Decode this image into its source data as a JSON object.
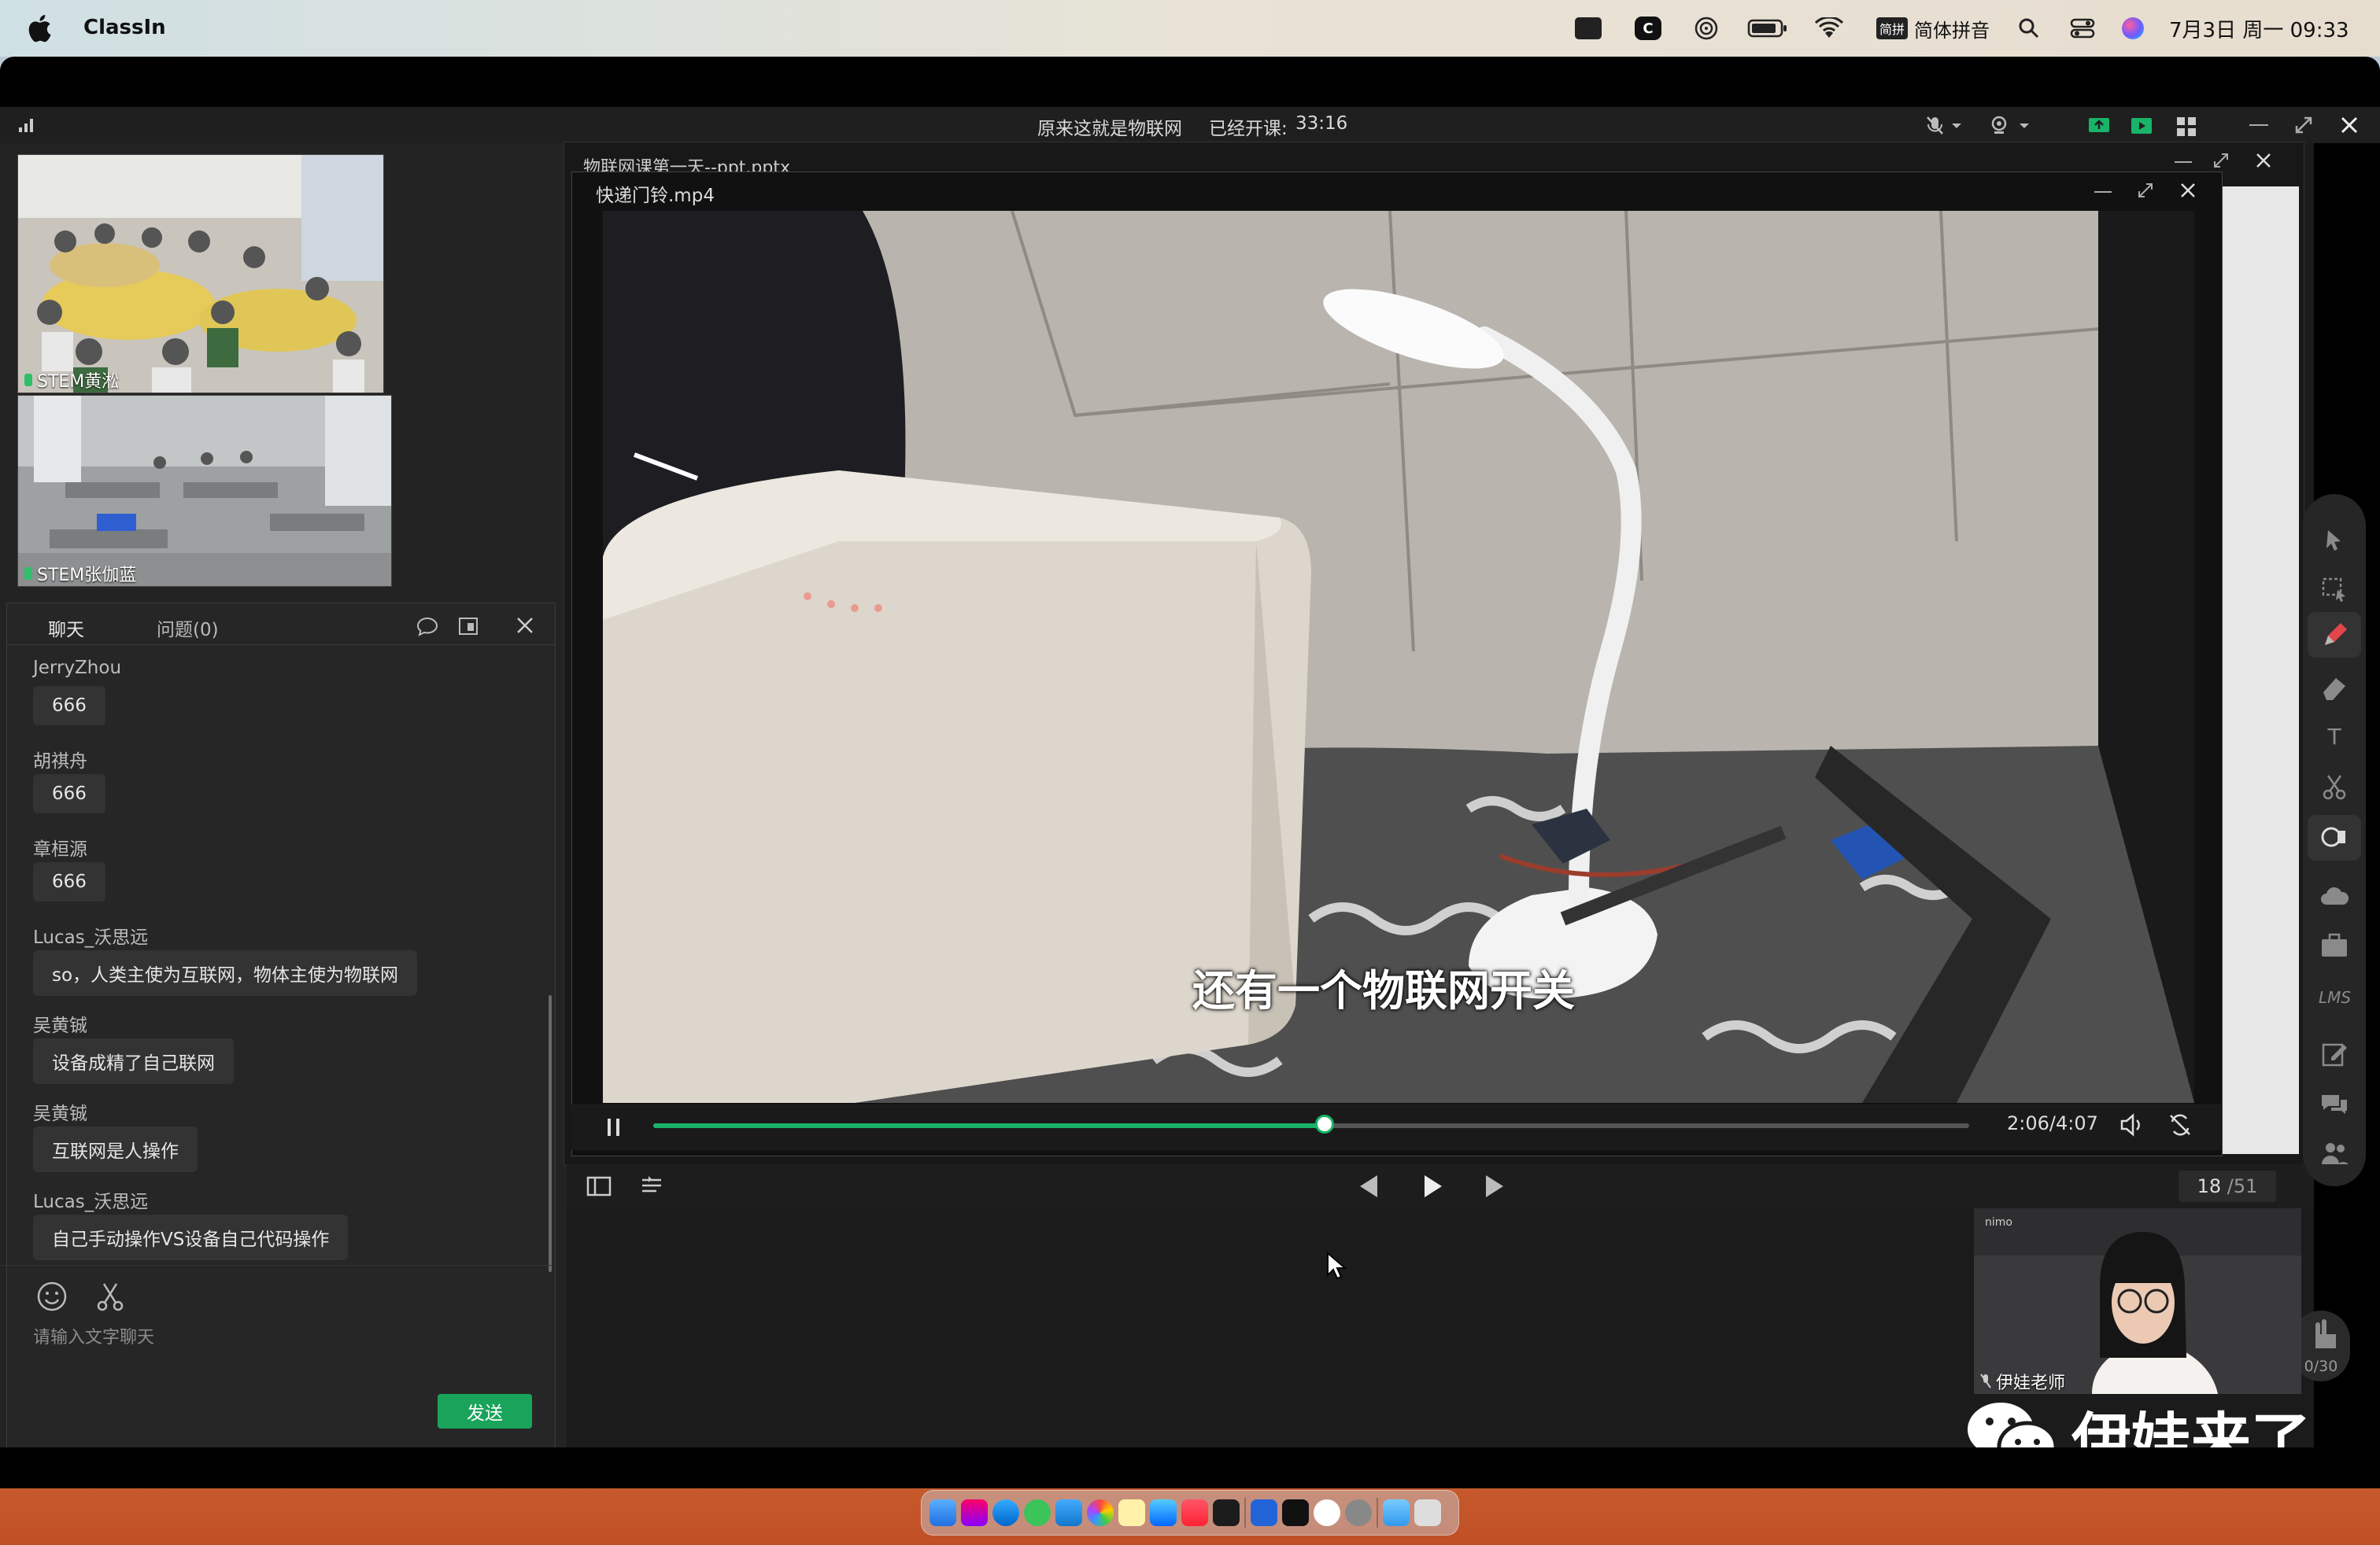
{
  "menubar": {
    "app_name": "ClassIn",
    "input_method": "简体拼音",
    "input_badge": "简拼",
    "datetime": "7月3日 周一 09:33",
    "icons": [
      "apple-icon",
      "feather-icon",
      "classin-icon",
      "airdrop-icon",
      "battery-icon",
      "wifi-icon",
      "input-icon",
      "search-icon",
      "control-center-icon",
      "siri-icon"
    ]
  },
  "window": {
    "course_title": "原来这就是物联网",
    "elapsed_label": "已经开课:",
    "elapsed": "33:16",
    "signal_icon": "signal-icon"
  },
  "students": [
    {
      "name": "STEM黄淞"
    },
    {
      "name": "STEM张伽蓝"
    }
  ],
  "chat": {
    "tab_chat": "聊天",
    "tab_questions": "问题(0)",
    "messages": [
      {
        "user": "JerryZhou",
        "text": "666"
      },
      {
        "user": "胡祺舟",
        "text": "666"
      },
      {
        "user": "章桓源",
        "text": "666"
      },
      {
        "user": "Lucas_沃思远",
        "text": "so，人类主使为互联网，物体主使为物联网"
      },
      {
        "user": "吴黄铖",
        "text": "设备成精了自己联网"
      },
      {
        "user": "吴黄铖",
        "text": "互联网是人操作"
      },
      {
        "user": "Lucas_沃思远",
        "text": "自己手动操作VS设备自己代码操作"
      }
    ],
    "input_placeholder": "请输入文字聊天",
    "send_label": "发送"
  },
  "ppt": {
    "filename": "物联网课第一天--ppt.pptx",
    "current_page": "18",
    "total_pages": "/51"
  },
  "video": {
    "filename": "快递门铃.mp4",
    "subtitle": "还有一个物联网开关",
    "current_time": "2:06",
    "total_time": "/4:07",
    "progress": 0.51
  },
  "teacher": {
    "name": "伊娃老师",
    "brand": "nimo"
  },
  "toolbar": {
    "hand_count": "0/30",
    "lms": "LMS",
    "text_tool": "T"
  },
  "watermark": "伊娃来了",
  "colors": {
    "accent": "#19b36a",
    "send_button": "#1aa35b",
    "active_tool": "#e2454a"
  }
}
